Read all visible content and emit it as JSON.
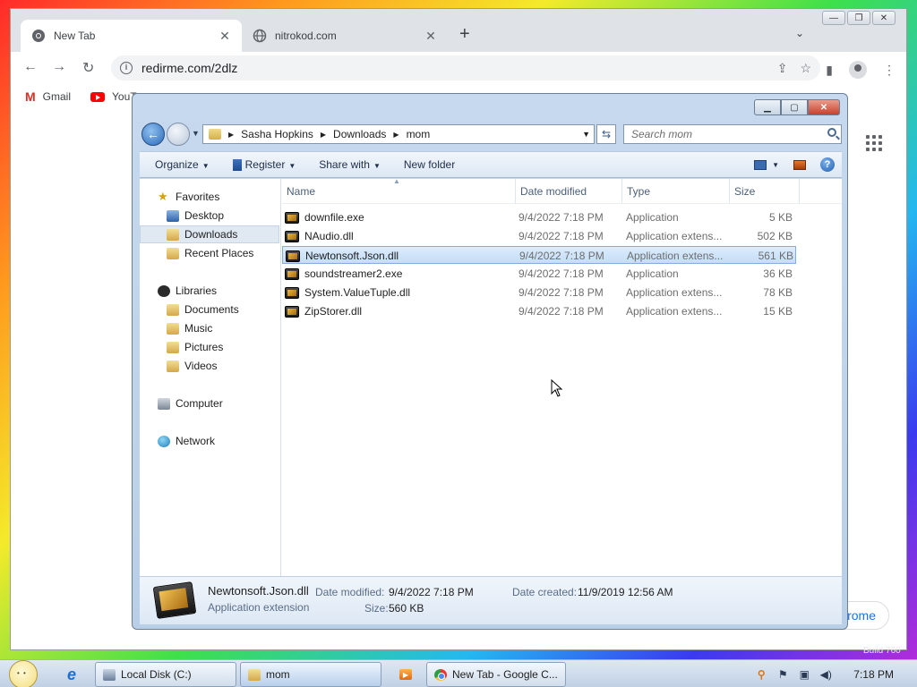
{
  "chrome": {
    "tabs": [
      {
        "title": "New Tab",
        "active": true
      },
      {
        "title": "nitrokod.com",
        "active": false
      }
    ],
    "new_tab_symbol": "+",
    "tab_search_symbol": "⌄",
    "address": "redirme.com/2dlz",
    "bookmarks": [
      {
        "label": "Gmail",
        "icon": "gmail-icon"
      },
      {
        "label": "YouTu",
        "icon": "youtube-icon"
      }
    ],
    "customize_label": "rome",
    "build_label": "Build 760"
  },
  "explorer": {
    "breadcrumb": [
      "Sasha Hopkins",
      "Downloads",
      "mom"
    ],
    "search_placeholder": "Search mom",
    "commands": {
      "organize": "Organize",
      "register": "Register",
      "share_with": "Share with",
      "new_folder": "New folder"
    },
    "nav": {
      "favorites": "Favorites",
      "desktop": "Desktop",
      "downloads": "Downloads",
      "recent_places": "Recent Places",
      "libraries": "Libraries",
      "documents": "Documents",
      "music": "Music",
      "pictures": "Pictures",
      "videos": "Videos",
      "computer": "Computer",
      "network": "Network"
    },
    "columns": {
      "name": "Name",
      "date_modified": "Date modified",
      "type": "Type",
      "size": "Size"
    },
    "files": [
      {
        "name": "downfile.exe",
        "date": "9/4/2022 7:18 PM",
        "type": "Application",
        "size": "5 KB"
      },
      {
        "name": "NAudio.dll",
        "date": "9/4/2022 7:18 PM",
        "type": "Application extens...",
        "size": "502 KB"
      },
      {
        "name": "Newtonsoft.Json.dll",
        "date": "9/4/2022 7:18 PM",
        "type": "Application extens...",
        "size": "561 KB"
      },
      {
        "name": "soundstreamer2.exe",
        "date": "9/4/2022 7:18 PM",
        "type": "Application",
        "size": "36 KB"
      },
      {
        "name": "System.ValueTuple.dll",
        "date": "9/4/2022 7:18 PM",
        "type": "Application extens...",
        "size": "78 KB"
      },
      {
        "name": "ZipStorer.dll",
        "date": "9/4/2022 7:18 PM",
        "type": "Application extens...",
        "size": "15 KB"
      }
    ],
    "selected_index": 2,
    "details": {
      "name": "Newtonsoft.Json.dll",
      "kind": "Application extension",
      "date_modified_label": "Date modified:",
      "date_modified": "9/4/2022 7:18 PM",
      "date_created_label": "Date created:",
      "date_created": "11/9/2019 12:56 AM",
      "size_label": "Size:",
      "size": "560 KB"
    }
  },
  "taskbar": {
    "buttons": [
      {
        "label": "Local Disk (C:)",
        "icon": "disk-icon"
      },
      {
        "label": "mom",
        "icon": "folder-icon"
      },
      {
        "label": "New Tab - Google C...",
        "icon": "chrome-icon"
      }
    ],
    "clock": "7:18 PM"
  }
}
